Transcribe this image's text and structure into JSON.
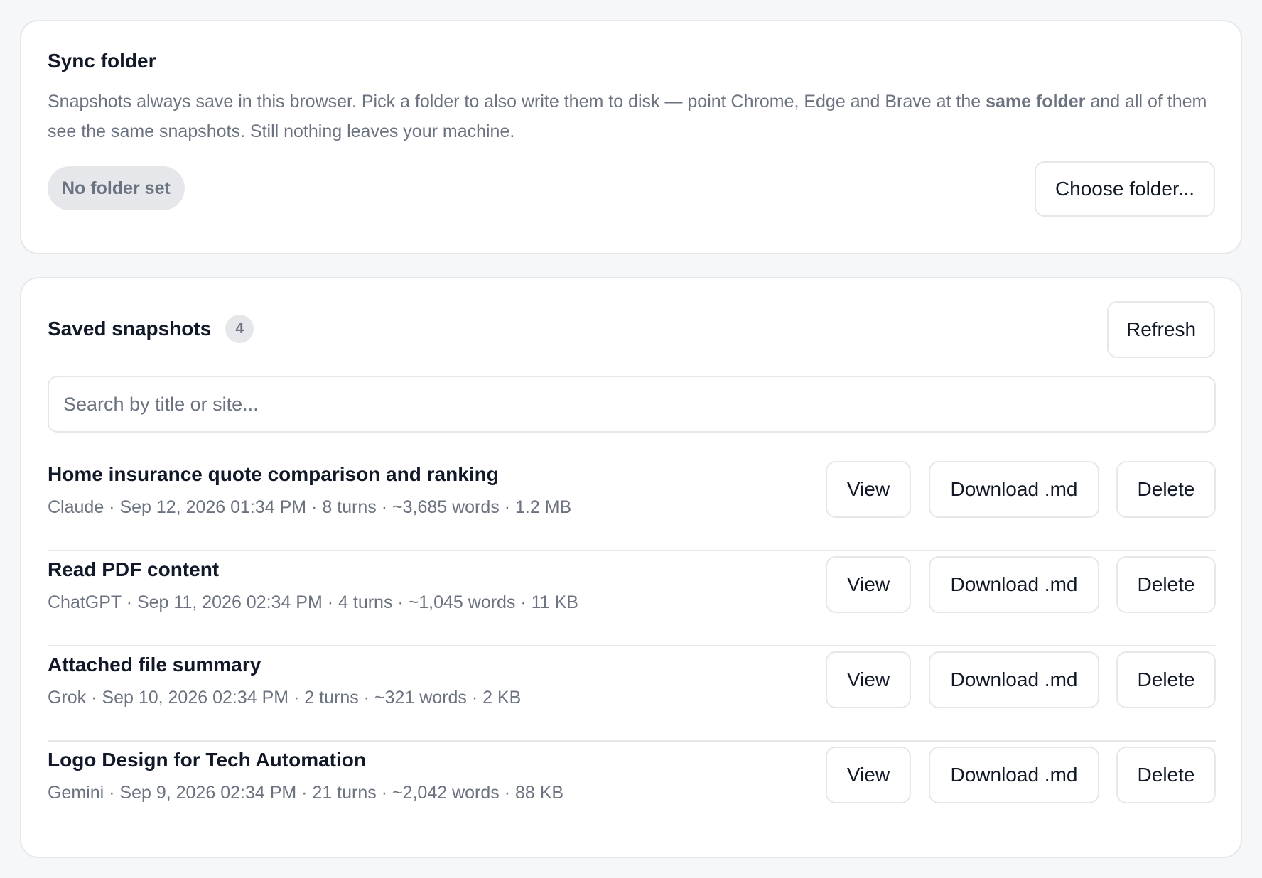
{
  "sync": {
    "title": "Sync folder",
    "desc_before": "Snapshots always save in this browser. Pick a folder to also write them to disk — point Chrome, Edge and Brave at the ",
    "desc_bold": "same folder",
    "desc_after": " and all of them see the same snapshots. Still nothing leaves your machine.",
    "folder_status": "No folder set",
    "choose_label": "Choose folder..."
  },
  "saved": {
    "title": "Saved snapshots",
    "count": "4",
    "refresh_label": "Refresh",
    "search_placeholder": "Search by title or site...",
    "items": [
      {
        "title": "Home insurance quote comparison and ranking",
        "meta": "Claude · Sep 12, 2026 01:34 PM · 8 turns · ~3,685 words · 1.2 MB",
        "view": "View",
        "download": "Download .md",
        "delete": "Delete"
      },
      {
        "title": "Read PDF content",
        "meta": "ChatGPT · Sep 11, 2026 02:34 PM · 4 turns · ~1,045 words · 11 KB",
        "view": "View",
        "download": "Download .md",
        "delete": "Delete"
      },
      {
        "title": "Attached file summary",
        "meta": "Grok · Sep 10, 2026 02:34 PM · 2 turns · ~321 words · 2 KB",
        "view": "View",
        "download": "Download .md",
        "delete": "Delete"
      },
      {
        "title": "Logo Design for Tech Automation",
        "meta": "Gemini · Sep 9, 2026 02:34 PM · 21 turns · ~2,042 words · 88 KB",
        "view": "View",
        "download": "Download .md",
        "delete": "Delete"
      }
    ]
  }
}
